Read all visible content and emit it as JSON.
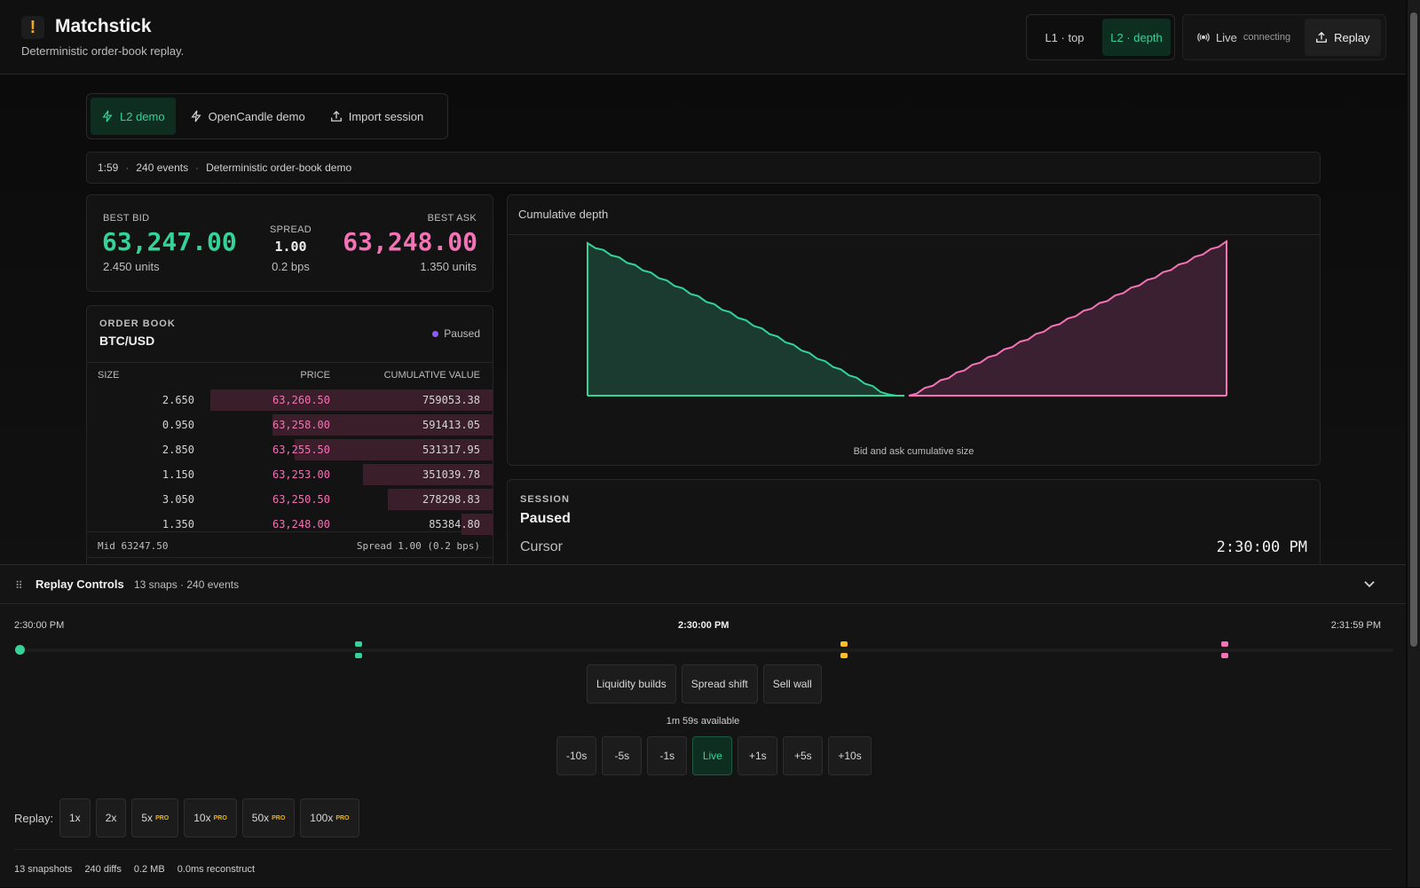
{
  "header": {
    "logo_glyph": "!",
    "title": "Matchstick",
    "subtitle": "Deterministic order-book replay.",
    "levels": [
      {
        "label": "L1 · top",
        "active": false
      },
      {
        "label": "L2 · depth",
        "active": true
      }
    ],
    "live_label": "Live",
    "live_state": "connecting",
    "replay_label": "Replay"
  },
  "sources": {
    "tabs": [
      {
        "label": "L2 demo",
        "icon": "bolt-icon",
        "active": true
      },
      {
        "label": "OpenCandle demo",
        "icon": "bolt-icon",
        "active": false
      },
      {
        "label": "Import session",
        "icon": "upload-icon",
        "active": false
      }
    ]
  },
  "info": {
    "duration": "1:59",
    "events": "240 events",
    "description": "Deterministic order-book demo"
  },
  "quote": {
    "best_bid_label": "BEST BID",
    "best_bid": "63,247.00",
    "bid_units": "2.450 units",
    "spread_label": "SPREAD",
    "spread": "1.00",
    "spread_bps": "0.2 bps",
    "best_ask_label": "BEST ASK",
    "best_ask": "63,248.00",
    "ask_units": "1.350 units",
    "bid_color": "#34d399",
    "ask_color": "#f472b6"
  },
  "book": {
    "kicker": "ORDER BOOK",
    "pair": "BTC/USD",
    "status": "Paused",
    "columns": {
      "size": "SIZE",
      "price": "PRICE",
      "cumulative": "CUMULATIVE VALUE"
    },
    "asks": [
      {
        "size": "2.650",
        "price": "63,260.50",
        "cum": "759053.38",
        "depth_pct": 100
      },
      {
        "size": "0.950",
        "price": "63,258.00",
        "cum": "591413.05",
        "depth_pct": 78
      },
      {
        "size": "2.850",
        "price": "63,255.50",
        "cum": "531317.95",
        "depth_pct": 70
      },
      {
        "size": "1.150",
        "price": "63,253.00",
        "cum": "351039.78",
        "depth_pct": 46
      },
      {
        "size": "3.050",
        "price": "63,250.50",
        "cum": "278298.83",
        "depth_pct": 37
      },
      {
        "size": "1.350",
        "price": "63,248.00",
        "cum": "85384.80",
        "depth_pct": 11
      }
    ],
    "mid": "Mid 63247.50",
    "spread": "Spread 1.00 (0.2 bps)"
  },
  "depth": {
    "title": "Cumulative depth",
    "caption": "Bid and ask cumulative size",
    "bid_color": "#34d399",
    "ask_color": "#f472b6"
  },
  "session": {
    "kicker": "SESSION",
    "status": "Paused",
    "cursor_label": "Cursor",
    "cursor_value": "2:30:00 PM"
  },
  "controls": {
    "title": "Replay Controls",
    "meta": "13 snaps · 240 events",
    "timeline": {
      "start": "2:30:00 PM",
      "current": "2:30:00 PM",
      "end": "2:31:59 PM",
      "cursor_fraction": 0
    },
    "markers": [
      {
        "fraction": 0.247,
        "color": "#34d399"
      },
      {
        "fraction": 0.6,
        "color": "#fbbf24"
      },
      {
        "fraction": 0.877,
        "color": "#f472b6"
      }
    ],
    "events": [
      "Liquidity builds",
      "Spread shift",
      "Sell wall"
    ],
    "available": "1m 59s available",
    "steps": [
      "-10s",
      "-5s",
      "-1s",
      "Live",
      "+1s",
      "+5s",
      "+10s"
    ],
    "speed_label": "Replay:",
    "speeds": [
      {
        "label": "1x",
        "pro": false
      },
      {
        "label": "2x",
        "pro": false
      },
      {
        "label": "5x",
        "pro": true
      },
      {
        "label": "10x",
        "pro": true
      },
      {
        "label": "50x",
        "pro": true
      },
      {
        "label": "100x",
        "pro": true
      }
    ],
    "pro_badge": "PRO",
    "stats": [
      "13 snapshots",
      "240 diffs",
      "0.2 MB",
      "0.0ms reconstruct"
    ]
  }
}
